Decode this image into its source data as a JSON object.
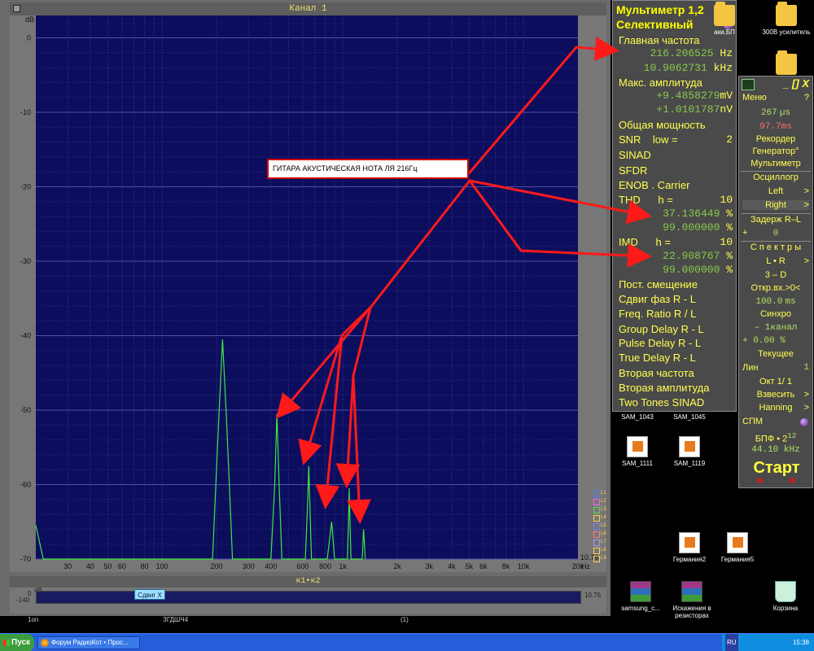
{
  "window": {
    "channel_title": "Канал 1",
    "bottom_title": "к1•к2",
    "shift_button": "Сдвиг X",
    "bottom_db_unit": "dB",
    "bottom_db_top": "0",
    "bottom_db_bottom": "-140",
    "bottom_right_value": "10.76",
    "left_stub_text": "1оп",
    "bottom_mid_text": "(1)",
    "bottom_left_text": "ЗГДШЧ4"
  },
  "chart_data": {
    "type": "line",
    "title": "Канал 1",
    "ylabel": "dB",
    "xlabel": "Hz",
    "x_scale": "log",
    "xlim": [
      20,
      20000
    ],
    "ylim": [
      -70,
      3
    ],
    "y_ticks": [
      0,
      -10,
      -20,
      -30,
      -40,
      -50,
      -60,
      -70
    ],
    "x_ticks": [
      "30",
      "40",
      "50",
      "60",
      "80",
      "100",
      "200",
      "300",
      "400",
      "600",
      "800",
      "1k",
      "2k",
      "3k",
      "4k",
      "5k",
      "6k",
      "8k",
      "10k",
      "20k"
    ],
    "x_tick_values": [
      30,
      40,
      50,
      60,
      80,
      100,
      200,
      300,
      400,
      600,
      800,
      1000,
      2000,
      3000,
      4000,
      5000,
      6000,
      8000,
      10000,
      20000
    ],
    "grid": true,
    "series": [
      {
        "x": [
          20,
          22,
          190,
          205,
          216,
          228,
          245,
          400,
          420,
          432,
          444,
          460,
          620,
          640,
          648,
          656,
          670,
          820,
          858,
          866,
          874,
          900,
          1060,
          1080,
          1085,
          1090,
          1110,
          1280,
          1296,
          1302,
          1310,
          1330
        ],
        "values": [
          -65.5,
          -70,
          -70,
          -52,
          -40.5,
          -52,
          -70,
          -70,
          -60,
          -50.5,
          -60,
          -70,
          -70,
          -62,
          -57.5,
          -62,
          -70,
          -70,
          -66,
          -65,
          -66,
          -70,
          -70,
          -63,
          -60.5,
          -63,
          -70,
          -70,
          -67,
          -66,
          -67,
          -70
        ]
      }
    ],
    "right_corner_value": "10.76",
    "legend": [
      "L1",
      "L2",
      "L3",
      "L4",
      "L5",
      "L6",
      "L7",
      "L8",
      "L9"
    ],
    "legend_colors": [
      "#4f7fff",
      "#ff5cff",
      "#4fe24f",
      "#ffd24d",
      "#7f7fff",
      "#ff7f7f",
      "#a0a0ff",
      "#ffd24d",
      "#ffd24d"
    ]
  },
  "annotation": {
    "note": "ГИТАРА  АКУСТИЧЕСКАЯ НОТА  ЛЯ  216Гц"
  },
  "multimeter": {
    "title": "Мультиметр 1,2",
    "help": "?",
    "mode": "Селективный",
    "main_freq_label": "Главная частота",
    "main_freq_val1": "216.206525",
    "main_freq_unit1": "Hz",
    "main_freq_val2": "10.9062731",
    "main_freq_unit2": "kHz",
    "max_amp_label": "Макс. амплитуда",
    "max_amp_val1": "+9.4858279",
    "max_amp_unit1": "mV",
    "max_amp_val2": "+1.0101787",
    "max_amp_unit2": "nV",
    "total_power": "Общая мощность",
    "snr": "SNR",
    "snr_low": "low =",
    "snr_low_val": "2",
    "sinad": "SINAD",
    "sfdr": "SFDR",
    "enob": "ENOB . Carrier",
    "thd": "THD",
    "thd_h": "h =",
    "thd_h_val": "10",
    "thd_val1": "37.136449",
    "thd_val2": "99.000000",
    "imd": "IMD",
    "imd_h": "h =",
    "imd_h_val": "10",
    "imd_val1": "22.908767",
    "imd_val2": "99.000000",
    "pct": "%",
    "dc_offset": "Пост. смещение",
    "phase_shift": "Сдвиг фаз R - L",
    "freq_ratio": "Freq. Ratio  R / L",
    "group_delay": "Group Delay R - L",
    "pulse_delay": "Pulse Delay R - L",
    "true_delay": "True Delay R - L",
    "second_freq": "Вторая частота",
    "second_amp": "Вторая амплитуда",
    "two_tones": "Two Tones SINAD"
  },
  "control": {
    "close": "_ [] X",
    "menu": "Меню",
    "menu_help": "?",
    "time1": "267",
    "time1_unit": "µs",
    "time2": "97.7",
    "time2_unit": "ms",
    "recorder": "Рекордер",
    "generator": "Генератор°",
    "multimeter": "Мультиметр",
    "oscilloscope": "Осциллогр",
    "left": "Left",
    "right": "Right",
    "arrow": ">",
    "delay": "Задерж  R–L",
    "delay_sign": "+",
    "delay_val": "0",
    "spectra": "С п е к т р ы",
    "lr": "L • R",
    "d3": "3 – D",
    "open_input": "Откр.вх.>0<",
    "open_val": "100.0",
    "open_unit": "ms",
    "sync": "Синхро",
    "sync_val": "– 1канал",
    "sync_pct": "+ 0.00 %",
    "current": "Текущее",
    "lin": "Лин",
    "lin_val": "1",
    "oct": "Окт  1/ 1",
    "weigh": "Взвесить",
    "hanning": "Hanning",
    "spm": "СПМ",
    "fft": "БПФ • 2",
    "fft_exp": "12",
    "sample_rate": "44.10 kHz",
    "start": "Старт"
  },
  "desktop": {
    "icons": [
      {
        "label": "аки,БП",
        "type": "folder"
      },
      {
        "label": "300В усилитель",
        "type": "folder"
      },
      {
        "label": "SAM_1043",
        "type": "img"
      },
      {
        "label": "SAM_1045",
        "type": "img"
      },
      {
        "label": "SAM_1111",
        "type": "img"
      },
      {
        "label": "SAM_1119",
        "type": "img"
      },
      {
        "label": "Германия2",
        "type": "img"
      },
      {
        "label": "Германия5",
        "type": "img"
      },
      {
        "label": "samsung_c...",
        "type": "zip"
      },
      {
        "label": "Искажения в резисторах",
        "type": "zip"
      },
      {
        "label": "Корзина",
        "type": "bin"
      }
    ]
  },
  "taskbar": {
    "start": "Пуск",
    "task1": "Форум РадиоКот • Прос...",
    "lang": "RU",
    "clock": "15:38"
  }
}
